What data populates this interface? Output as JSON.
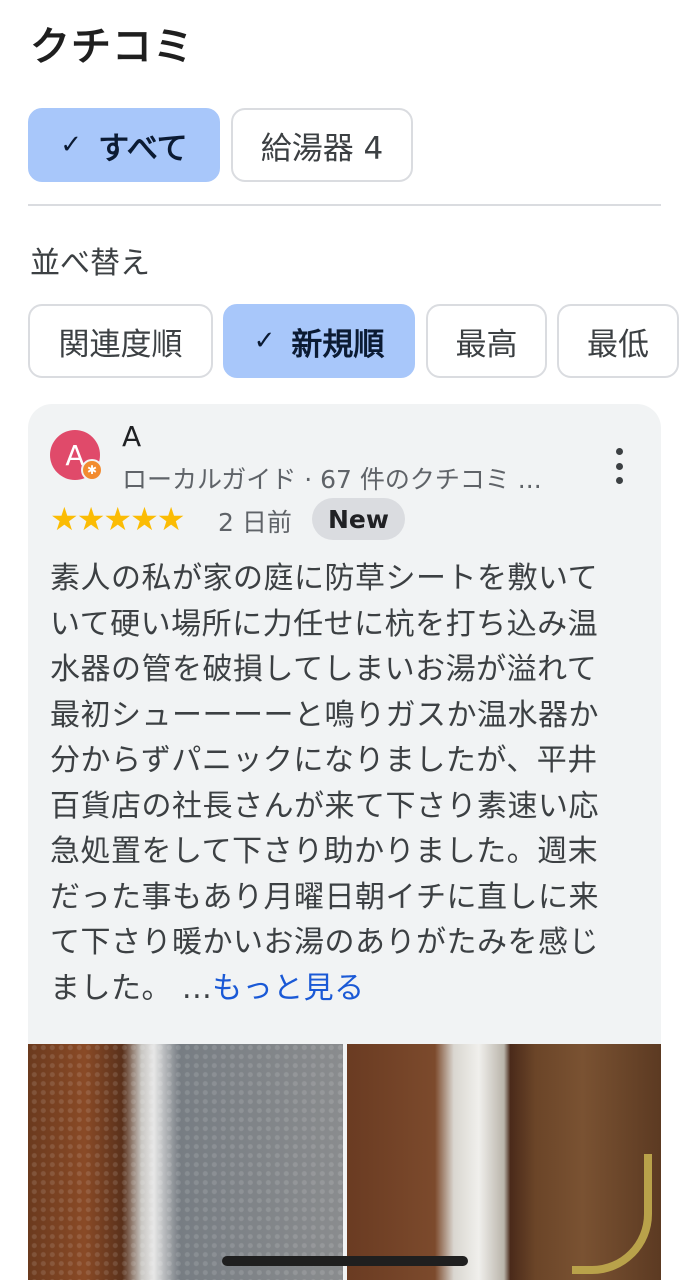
{
  "header": {
    "title": "クチコミ"
  },
  "topic_chips": [
    {
      "label": "すべて",
      "selected": true,
      "check": "✓"
    },
    {
      "label": "給湯器 4",
      "selected": false
    }
  ],
  "sort": {
    "label": "並べ替え",
    "options": [
      {
        "label": "関連度順",
        "selected": false
      },
      {
        "label": "新規順",
        "selected": true,
        "check": "✓"
      },
      {
        "label": "最高",
        "selected": false
      },
      {
        "label": "最低",
        "selected": false
      }
    ]
  },
  "review": {
    "avatar_letter": "A",
    "avatar_color": "#e04a6a",
    "reviewer_name": "A",
    "reviewer_meta": "ローカルガイド · 67 件のクチコミ ...",
    "stars": "★★★★★",
    "rating": 5,
    "time": "2 日前",
    "badge": "New",
    "text_lines": [
      "素人の私が家の庭に防草シートを敷いて",
      "いて硬い場所に力任せに杭を打ち込み温",
      "水器の管を破損してしまいお湯が溢れて",
      "最初シューーーーと鳴りガスか温水器か",
      "分からずパニックになりましたが、平井",
      "百貨店の社長さんが来て下さり素速い応",
      "急処置をして下さり助かりました。週末",
      "だった事もあり月曜日朝イチに直しに来",
      "て下さり暖かいお湯のありがたみを感じ",
      "ました。 ..."
    ],
    "more_link": "もっと見る"
  },
  "colors": {
    "accent": "#a8c7fa",
    "link": "#1a59d6",
    "star": "#fbbc04"
  }
}
